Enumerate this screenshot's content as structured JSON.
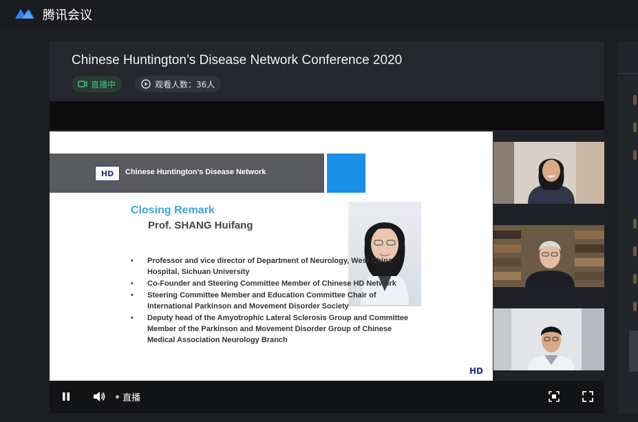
{
  "app": {
    "name": "腾讯会议"
  },
  "meeting": {
    "title": "Chinese Huntington’s Disease Network Conference 2020",
    "live_label": "直播中",
    "viewers_label": "观看人数：36人"
  },
  "slide": {
    "header_text": "Chinese Huntington’s Disease Network",
    "logo_text": "HD",
    "heading": "Closing Remark",
    "speaker": "Prof. SHANG Huifang",
    "bullets": [
      "Professor and vice director of Department of Neurology, West China Hospital, Sichuan University",
      "Co-Founder and Steering Committee Member of Chinese HD Network",
      "Steering Committee Member and Education Committee Chair of International Parkinson and Movement Disorder Society",
      "Deputy head of the Amyotrophic Lateral Sclerosis Group and Committee Member of the Parkinson and Movement Disorder Group of Chinese Medical Association Neurology Branch"
    ],
    "footer_logo": "HD"
  },
  "controls": {
    "live_text": "直播"
  },
  "colors": {
    "accent_green": "#3cc07a",
    "slide_blue": "#1c8fe8",
    "heading_blue": "#3aa6d4"
  }
}
